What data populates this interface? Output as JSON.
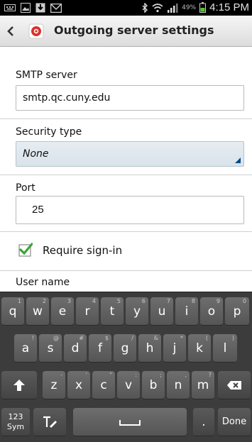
{
  "status_bar": {
    "battery_percent": "49%",
    "time": "4:15 PM",
    "icons": [
      "keyboard-icon",
      "image-icon",
      "download-icon",
      "gmail-icon",
      "bluetooth-icon",
      "wifi-icon",
      "signal-icon",
      "battery-icon"
    ]
  },
  "action_bar": {
    "title": "Outgoing server settings",
    "back_icon": "chevron-left-icon",
    "app_icon": "email-app-icon"
  },
  "form": {
    "smtp_label": "SMTP server",
    "smtp_value": "smtp.qc.cuny.edu",
    "security_label": "Security type",
    "security_value": "None",
    "port_label": "Port",
    "port_value": "25",
    "require_signin_label": "Require sign-in",
    "require_signin_checked": true,
    "username_label": "User name"
  },
  "keyboard": {
    "row1": [
      {
        "key": "q",
        "hint": "1"
      },
      {
        "key": "w",
        "hint": "2"
      },
      {
        "key": "e",
        "hint": "3"
      },
      {
        "key": "r",
        "hint": "4"
      },
      {
        "key": "t",
        "hint": "5"
      },
      {
        "key": "y",
        "hint": "6"
      },
      {
        "key": "u",
        "hint": "7"
      },
      {
        "key": "i",
        "hint": "8"
      },
      {
        "key": "o",
        "hint": "9"
      },
      {
        "key": "p",
        "hint": "0"
      }
    ],
    "row2": [
      {
        "key": "a",
        "hint": "!"
      },
      {
        "key": "s",
        "hint": "@"
      },
      {
        "key": "d",
        "hint": "#"
      },
      {
        "key": "f",
        "hint": "$"
      },
      {
        "key": "g",
        "hint": "/"
      },
      {
        "key": "h",
        "hint": "&"
      },
      {
        "key": "j",
        "hint": "*"
      },
      {
        "key": "k",
        "hint": "("
      },
      {
        "key": "l",
        "hint": ")"
      }
    ],
    "row3": [
      {
        "key": "z",
        "hint": "-"
      },
      {
        "key": "x",
        "hint": "'"
      },
      {
        "key": "c",
        "hint": "\""
      },
      {
        "key": "v",
        "hint": ":"
      },
      {
        "key": "b",
        "hint": ";"
      },
      {
        "key": "n",
        "hint": ","
      },
      {
        "key": "m",
        "hint": "?"
      }
    ],
    "sym_label_top": "123",
    "sym_label_bottom": "Sym",
    "period": ".",
    "done_label": "Done"
  },
  "colors": {
    "checkbox_green": "#3aa53a",
    "select_bg": "#dde6ec",
    "keyboard_bg": "#3c3c3c"
  }
}
